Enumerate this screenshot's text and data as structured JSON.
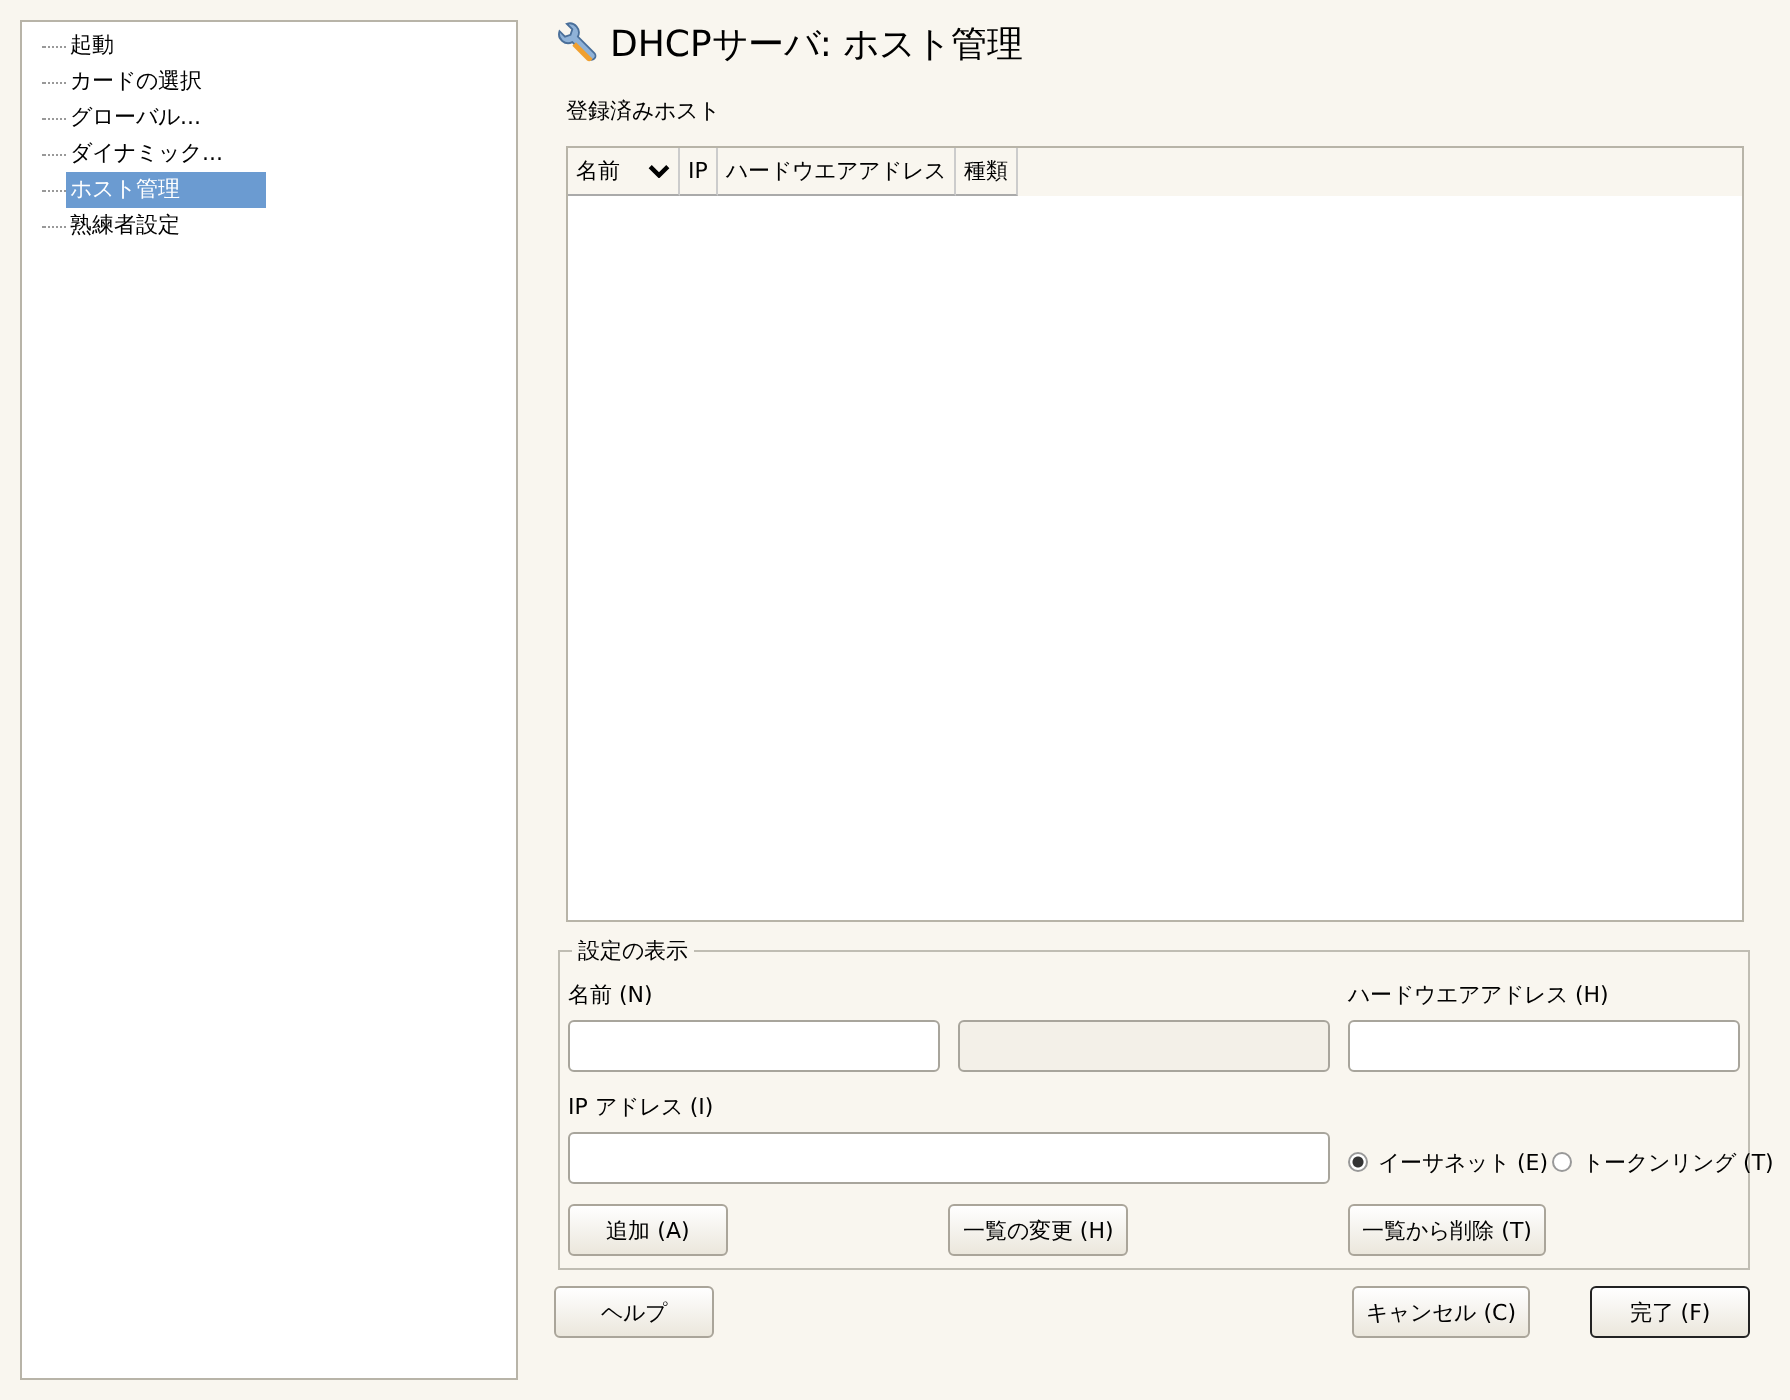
{
  "tree": [
    {
      "label": "起動",
      "selected": false
    },
    {
      "label": "カードの選択",
      "selected": false
    },
    {
      "label": "グローバル...",
      "selected": false
    },
    {
      "label": "ダイナミック...",
      "selected": false
    },
    {
      "label": "ホスト管理",
      "selected": true
    },
    {
      "label": "熟練者設定",
      "selected": false
    }
  ],
  "title": "DHCPサーバ: ホスト管理",
  "hosts_label": "登録済みホスト",
  "table": {
    "columns": [
      {
        "label": "名前",
        "sorted": true
      },
      {
        "label": "IP",
        "sorted": false
      },
      {
        "label": "ハードウエアアドレス",
        "sorted": false
      },
      {
        "label": "種類",
        "sorted": false
      }
    ]
  },
  "settings": {
    "title": "設定の表示",
    "name_label": "名前 (N)",
    "hw_label": "ハードウエアアドレス (H)",
    "ip_label": "IP アドレス (I)",
    "name_field_disabled": false,
    "domain_field_disabled": true,
    "radios": [
      {
        "label": "イーサネット (E)",
        "selected": true
      },
      {
        "label": "トークンリング (T)",
        "selected": false
      }
    ],
    "buttons": [
      {
        "label": "追加 (A)"
      },
      {
        "label": "一覧の変更 (H)"
      },
      {
        "label": "一覧から削除 (T)"
      }
    ]
  },
  "footer": [
    {
      "label": "ヘルプ",
      "default": false
    },
    {
      "label": "キャンセル (C)",
      "default": false
    },
    {
      "label": "完了 (F)",
      "default": true
    }
  ]
}
